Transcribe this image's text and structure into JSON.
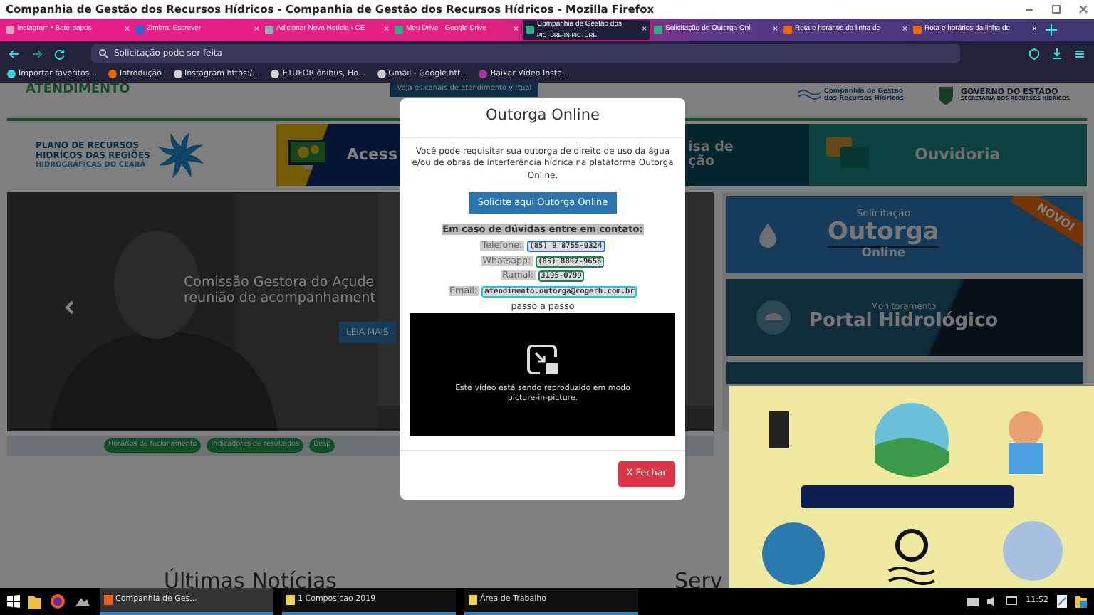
{
  "window": {
    "title": "Companhia de Gestão dos Recursos Hídricos - Companhia de Gestão dos Recursos Hídricos - Mozilla Firefox"
  },
  "tabs": [
    {
      "label": "Instagram • Bate-papos",
      "close": "×",
      "selected": false
    },
    {
      "label": "Zimbra: Escrever",
      "close": "×",
      "selected": false
    },
    {
      "label": "Adicionar Nova Notícia ‹ CE",
      "close": "×",
      "selected": false
    },
    {
      "label": "Meu Drive - Google Drive",
      "close": "×",
      "selected": false
    },
    {
      "label": "Companhia de Gestão dos",
      "sublabel": "PICTURE-IN-PICTURE",
      "close": "×",
      "selected": true
    },
    {
      "label": "Solicitação de Outorga Onli",
      "close": "×",
      "selected": false
    },
    {
      "label": "Rota e horários da linha de",
      "close": "×",
      "selected": false
    },
    {
      "label": "Rota e horários da linha de",
      "close": "×",
      "selected": false
    }
  ],
  "address_bar": {
    "value": "Solicitação pode ser feita"
  },
  "bookmarks": [
    "Importar favoritos...",
    "Introdução",
    "Instagram https:/...",
    "ETUFOR ônibus, Ho...",
    "Gmail - Google htt...",
    "Baixar Vídeo Insta..."
  ],
  "page": {
    "header": {
      "heading": "ATENDIMENTO",
      "channels_button": "Veja os canais de atendimento virtual",
      "company_logo": [
        "Companhia de Gestão",
        "dos Recursos Hídricos"
      ],
      "state_logo": "GOVERNO DO ESTADO",
      "state_sublogo": "SECRETARIA DOS RECURSOS HÍDRICOS"
    },
    "banners": [
      {
        "kind": "plan",
        "lines": [
          "PLANO DE RECURSOS",
          "HIDRÍCOS DAS REGIÕES",
          "HIDROGRÁFICAS DO CEARÁ"
        ]
      },
      {
        "kind": "access",
        "lines": [
          "Acess"
        ]
      },
      {
        "kind": "survey",
        "lines": [
          "isa de",
          "ção"
        ]
      },
      {
        "kind": "ombudsman",
        "lines": [
          "Ouvidoria"
        ]
      }
    ],
    "carousel": {
      "caption": [
        "Comissão Gestora do Açude",
        "reunião de acompanhament"
      ],
      "button": "LEIA MAIS"
    },
    "links": [
      "Horários de facionamento",
      "Indicadores de resultados",
      "Desp"
    ],
    "services": [
      {
        "kind": "outorga",
        "overline": "Solicitação",
        "title": "Outorga",
        "subtitle": "Online",
        "ribbon": "NOVO!"
      },
      {
        "kind": "portal",
        "overline": "Monitoramento",
        "title": "Portal Hidrológico"
      }
    ],
    "sections": [
      "Últimas Notícias",
      "Serv"
    ]
  },
  "modal": {
    "title": "Outorga Online",
    "text": "Você pode requisitar sua outorga de direito de uso da água e/ou de obras de interferência hídrica na plataforma Outorga Online.",
    "button": "Solicite aqui Outorga Online",
    "contact_heading": "Em caso de dúvidas entre em contato:",
    "contacts": [
      {
        "label": "Telefone:",
        "value": "(85) 9 8755-0324",
        "color": "#0d6efd"
      },
      {
        "label": "Whatsapp:",
        "value": "(85) 8897-9658",
        "color": "#198754"
      },
      {
        "label": "Ramal:",
        "value": "3195-0799",
        "color": "#198754"
      },
      {
        "label": "Email:",
        "value": "atendimento.outorga@cogerh.com.br",
        "color": "#0dcaf0"
      }
    ],
    "video_caption": "passo a passo",
    "video_message": "Este vídeo está sendo reproduzido em modo picture-in-picture.",
    "close": "X Fechar"
  },
  "taskbar": {
    "tasks": [
      {
        "label": "Companhia de Ges...",
        "selected": true
      },
      {
        "label": "1 Composicao 2019",
        "selected": false
      },
      {
        "label": "Área de Trabalho",
        "selected": false
      }
    ],
    "clock": "11:52"
  }
}
